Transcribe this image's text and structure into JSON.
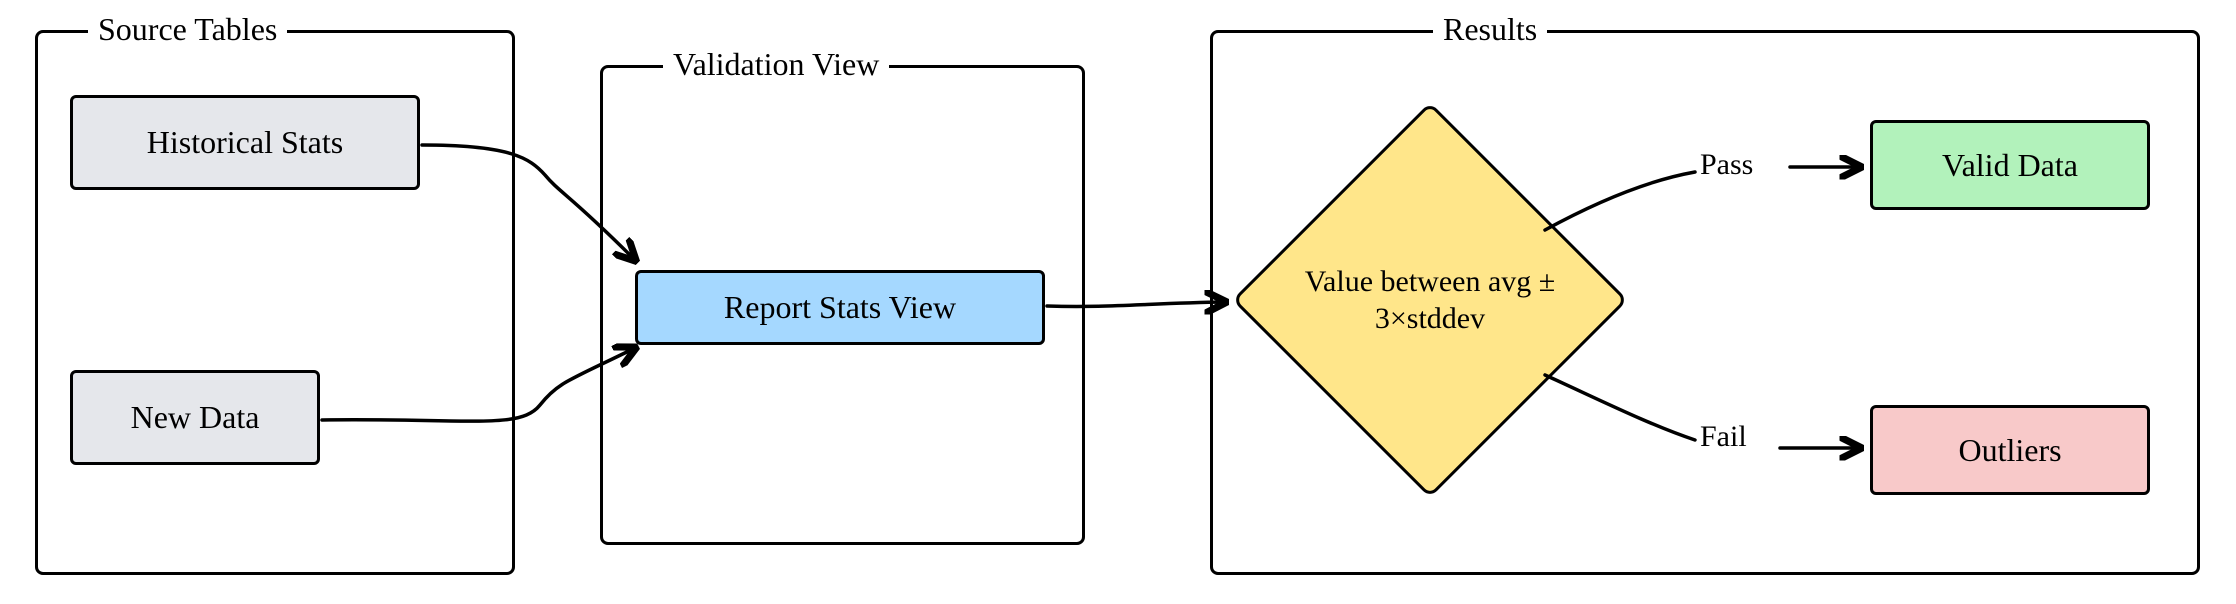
{
  "groups": {
    "source": {
      "label": "Source Tables"
    },
    "validation": {
      "label": "Validation View"
    },
    "results": {
      "label": "Results"
    }
  },
  "nodes": {
    "historical": {
      "label": "Historical Stats"
    },
    "newdata": {
      "label": "New Data"
    },
    "report": {
      "label": "Report Stats View"
    },
    "valid": {
      "label": "Valid Data"
    },
    "outliers": {
      "label": "Outliers"
    }
  },
  "decision": {
    "text": "Value between avg ± 3×stddev"
  },
  "edges": {
    "pass": {
      "label": "Pass"
    },
    "fail": {
      "label": "Fail"
    }
  },
  "colors": {
    "gray": "#e5e7eb",
    "blue": "#a5d8ff",
    "yellow": "#ffe68a",
    "green": "#b2f2bb",
    "red": "#f8c9c9"
  }
}
